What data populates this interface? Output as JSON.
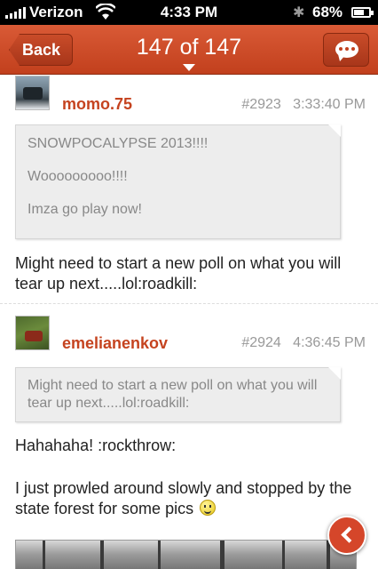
{
  "status_bar": {
    "carrier": "Verizon",
    "time": "4:33 PM",
    "battery_text": "68%",
    "battery_level": 0.68
  },
  "nav": {
    "back_label": "Back",
    "title": "147 of 147"
  },
  "posts": [
    {
      "username": "momo.75",
      "post_number": "#2923",
      "time": "3:33:40 PM",
      "quote_lines": [
        "SNOWPOCALYPSE 2013!!!!",
        "Wooooooooo!!!!",
        "Imza go play now!"
      ],
      "text": "Might need to start a new poll on what you will tear up next.....lol:roadkill:"
    },
    {
      "username": "emelianenkov",
      "post_number": "#2924",
      "time": "4:36:45 PM",
      "quote": "Might need to start a new poll on what you will tear up next.....lol:roadkill:",
      "text_1": "Hahahaha! :rockthrow:",
      "text_2": "I just prowled around slowly and stopped by the state forest for some pics"
    }
  ],
  "colors": {
    "accent": "#c5431f",
    "nav_bar": "#c2401d",
    "quote_bg": "#ededed"
  },
  "icons": [
    "signal-icon",
    "wifi-icon",
    "bluetooth-icon",
    "battery-icon",
    "chat-bubble-icon",
    "smiley-icon",
    "chevron-left-icon"
  ]
}
